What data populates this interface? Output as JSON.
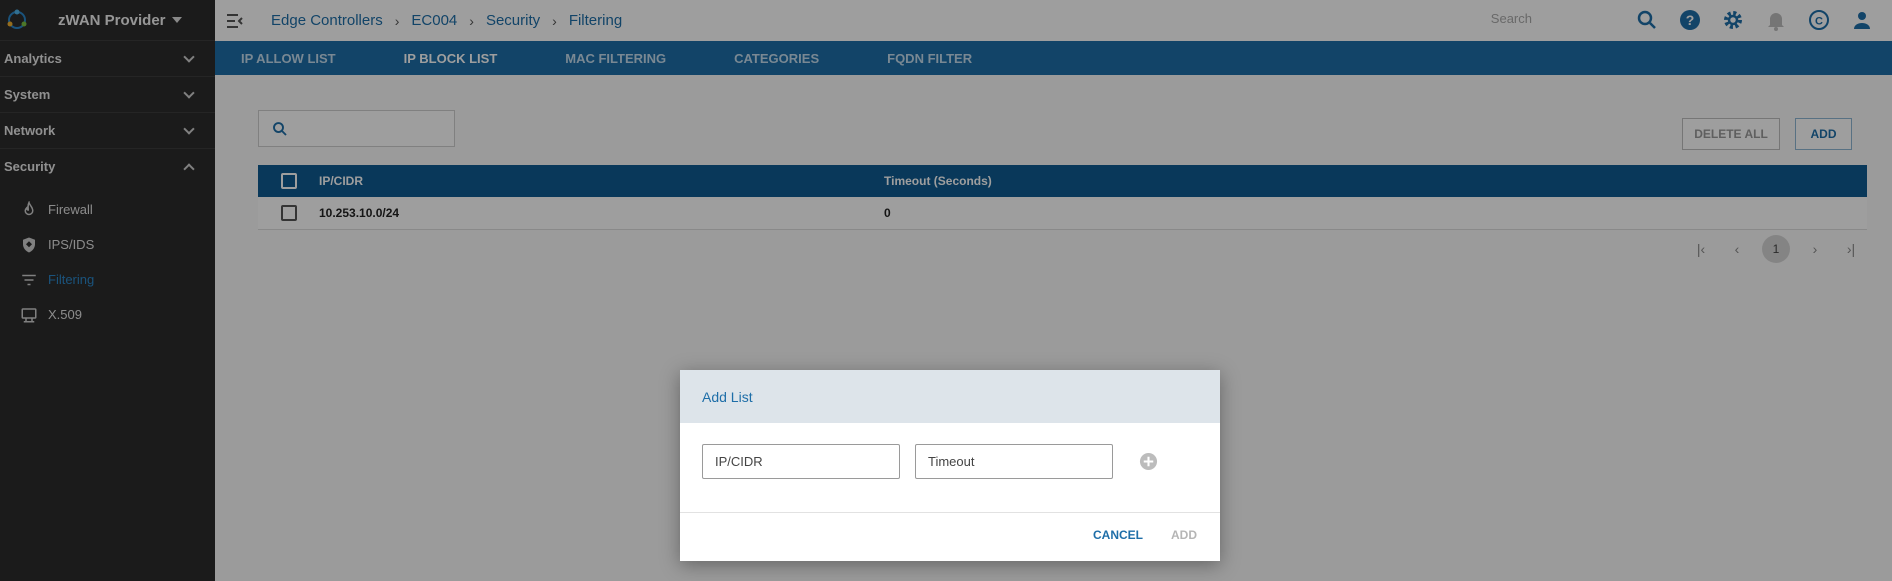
{
  "sidebar": {
    "brand": "zWAN Provider",
    "groups": [
      {
        "label": "Analytics"
      },
      {
        "label": "System"
      },
      {
        "label": "Network"
      },
      {
        "label": "Security"
      }
    ],
    "security_items": [
      {
        "label": "Firewall",
        "icon": "flame-icon"
      },
      {
        "label": "IPS/IDS",
        "icon": "shield-icon"
      },
      {
        "label": "Filtering",
        "icon": "filter-icon"
      },
      {
        "label": "X.509",
        "icon": "certificate-icon"
      }
    ]
  },
  "topbar": {
    "breadcrumb": [
      "Edge Controllers",
      "EC004",
      "Security",
      "Filtering"
    ],
    "search_placeholder": "Search"
  },
  "tabs": [
    "IP ALLOW LIST",
    "IP BLOCK LIST",
    "MAC FILTERING",
    "CATEGORIES",
    "FQDN FILTER"
  ],
  "toolbar": {
    "delete_all": "DELETE ALL",
    "add": "ADD"
  },
  "table": {
    "columns": [
      "IP/CIDR",
      "Timeout (Seconds)"
    ],
    "rows": [
      {
        "ip": "10.253.10.0/24",
        "timeout": "0"
      }
    ]
  },
  "pagination": {
    "current_page": "1"
  },
  "dialog": {
    "title": "Add List",
    "ip_placeholder": "IP/CIDR",
    "timeout_placeholder": "Timeout",
    "cancel": "CANCEL",
    "add": "ADD"
  },
  "colors": {
    "accent": "#1e6ea8",
    "sidebar_bg": "#2c2c2c",
    "table_header": "#0f5b91"
  }
}
